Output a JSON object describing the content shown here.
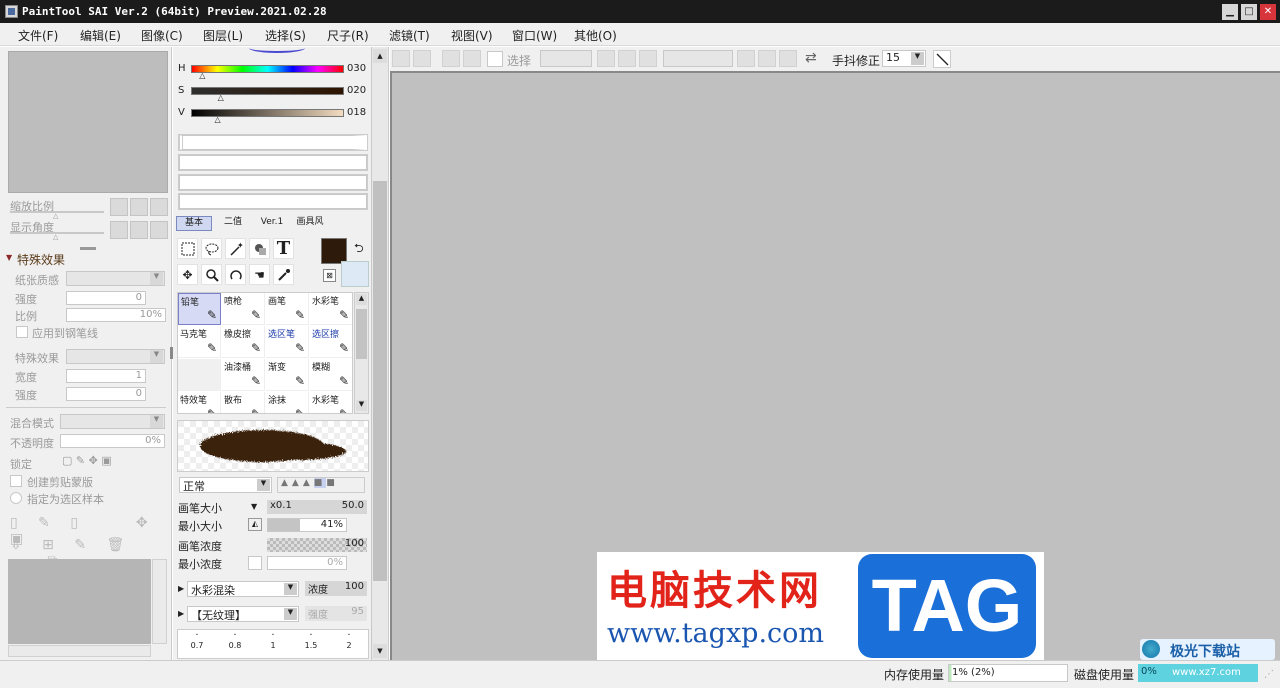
{
  "window": {
    "title": "PaintTool SAI Ver.2 (64bit) Preview.2021.02.28",
    "minimize_icon": "minimize-icon",
    "maximize_icon": "maximize-icon",
    "close_icon": "close-icon"
  },
  "menu": [
    "文件(F)",
    "编辑(E)",
    "图像(C)",
    "图层(L)",
    "选择(S)",
    "尺子(R)",
    "滤镜(T)",
    "视图(V)",
    "窗口(W)",
    "其他(O)"
  ],
  "nav": {
    "zoom_label": "缩放比例",
    "angle_label": "显示角度"
  },
  "effects": {
    "header": "特殊效果",
    "paper_label": "纸张质感",
    "strength_label": "强度",
    "strength_value": "0",
    "ratio_label": "比例",
    "ratio_value": "10%",
    "apply_pen_label": "应用到钢笔线",
    "effect_label": "特殊效果",
    "width_label": "宽度",
    "width_value": "1",
    "strength2_label": "强度",
    "strength2_value": "0"
  },
  "layer": {
    "blend_label": "混合模式",
    "opacity_label": "不透明度",
    "opacity_value": "0%",
    "lock_label": "锁定",
    "clip_label": "创建剪贴蒙版",
    "ref_label": "指定为选区样本"
  },
  "color": {
    "h_label": "H",
    "h_value": "030",
    "h_fraction": 0.08,
    "s_label": "S",
    "s_value": "020",
    "s_fraction": 0.2,
    "v_label": "V",
    "v_value": "018",
    "v_fraction": 0.18,
    "fg_color": "#2e1a0b",
    "bg_color": "#dde9f5",
    "swap_icon": "swap-arrows-icon",
    "transparent_icon": "transparent-icon"
  },
  "tabs": [
    "基本",
    "二值",
    "Ver.1",
    "画具风"
  ],
  "tools": [
    [
      "rect-select-icon",
      "lasso-icon",
      "magic-wand-icon",
      "fill-select-icon",
      "text-icon"
    ],
    [
      "move-icon",
      "zoom-icon",
      "rotate-icon",
      "hand-icon",
      "eyedropper-icon"
    ]
  ],
  "text_tool_glyph": "T",
  "brushes": [
    [
      {
        "name": "铅笔",
        "icon": "pencil-icon"
      },
      {
        "name": "喷枪",
        "icon": "airbrush-icon"
      },
      {
        "name": "画笔",
        "icon": "brush-icon"
      },
      {
        "name": "水彩笔",
        "icon": "watercolor-icon"
      }
    ],
    [
      {
        "name": "马克笔",
        "icon": "marker-icon"
      },
      {
        "name": "橡皮擦",
        "icon": "eraser-icon"
      },
      {
        "name": "选区笔",
        "icon": "select-pen-icon"
      },
      {
        "name": "选区擦",
        "icon": "select-eraser-icon"
      }
    ],
    [
      {
        "name": "",
        "icon": ""
      },
      {
        "name": "油漆桶",
        "icon": "bucket-icon"
      },
      {
        "name": "渐变",
        "icon": "gradient-icon"
      },
      {
        "name": "模糊",
        "icon": "blur-icon"
      }
    ],
    [
      {
        "name": "特效笔",
        "icon": "effect-pen-icon"
      },
      {
        "name": "散布",
        "icon": "scatter-icon"
      },
      {
        "name": "涂抹",
        "icon": "smudge-icon"
      },
      {
        "name": "水彩笔",
        "icon": "watercolor-icon"
      }
    ]
  ],
  "brush_settings": {
    "mode": "正常",
    "size_label": "画笔大小",
    "size_multiplier": "x0.1",
    "size_value": "50.0",
    "min_size_label": "最小大小",
    "min_size_value": "41%",
    "density_label": "画笔浓度",
    "density_value": "100",
    "min_density_label": "最小浓度",
    "min_density_value": "0%",
    "blend": "水彩混染",
    "blend_value_label": "浓度",
    "blend_value": "100",
    "texture": "【无纹理】",
    "texture_value_label": "强度",
    "texture_value": "95"
  },
  "brush_dots": [
    "0.7",
    "0.8",
    "1",
    "1.5",
    "2"
  ],
  "toolbar": {
    "select_label": "选择",
    "stabilizer_label": "手抖修正",
    "stabilizer_value": "15"
  },
  "status": {
    "memory_label": "内存使用量",
    "memory_value": "1% (2%)",
    "disk_label": "磁盘使用量",
    "disk_value": "0%"
  },
  "watermark": {
    "cn": "电脑技术网",
    "url": "www.tagxp.com",
    "tag": "TAG",
    "corner": "极光下载站",
    "corner_url": "www.xz7.com"
  }
}
